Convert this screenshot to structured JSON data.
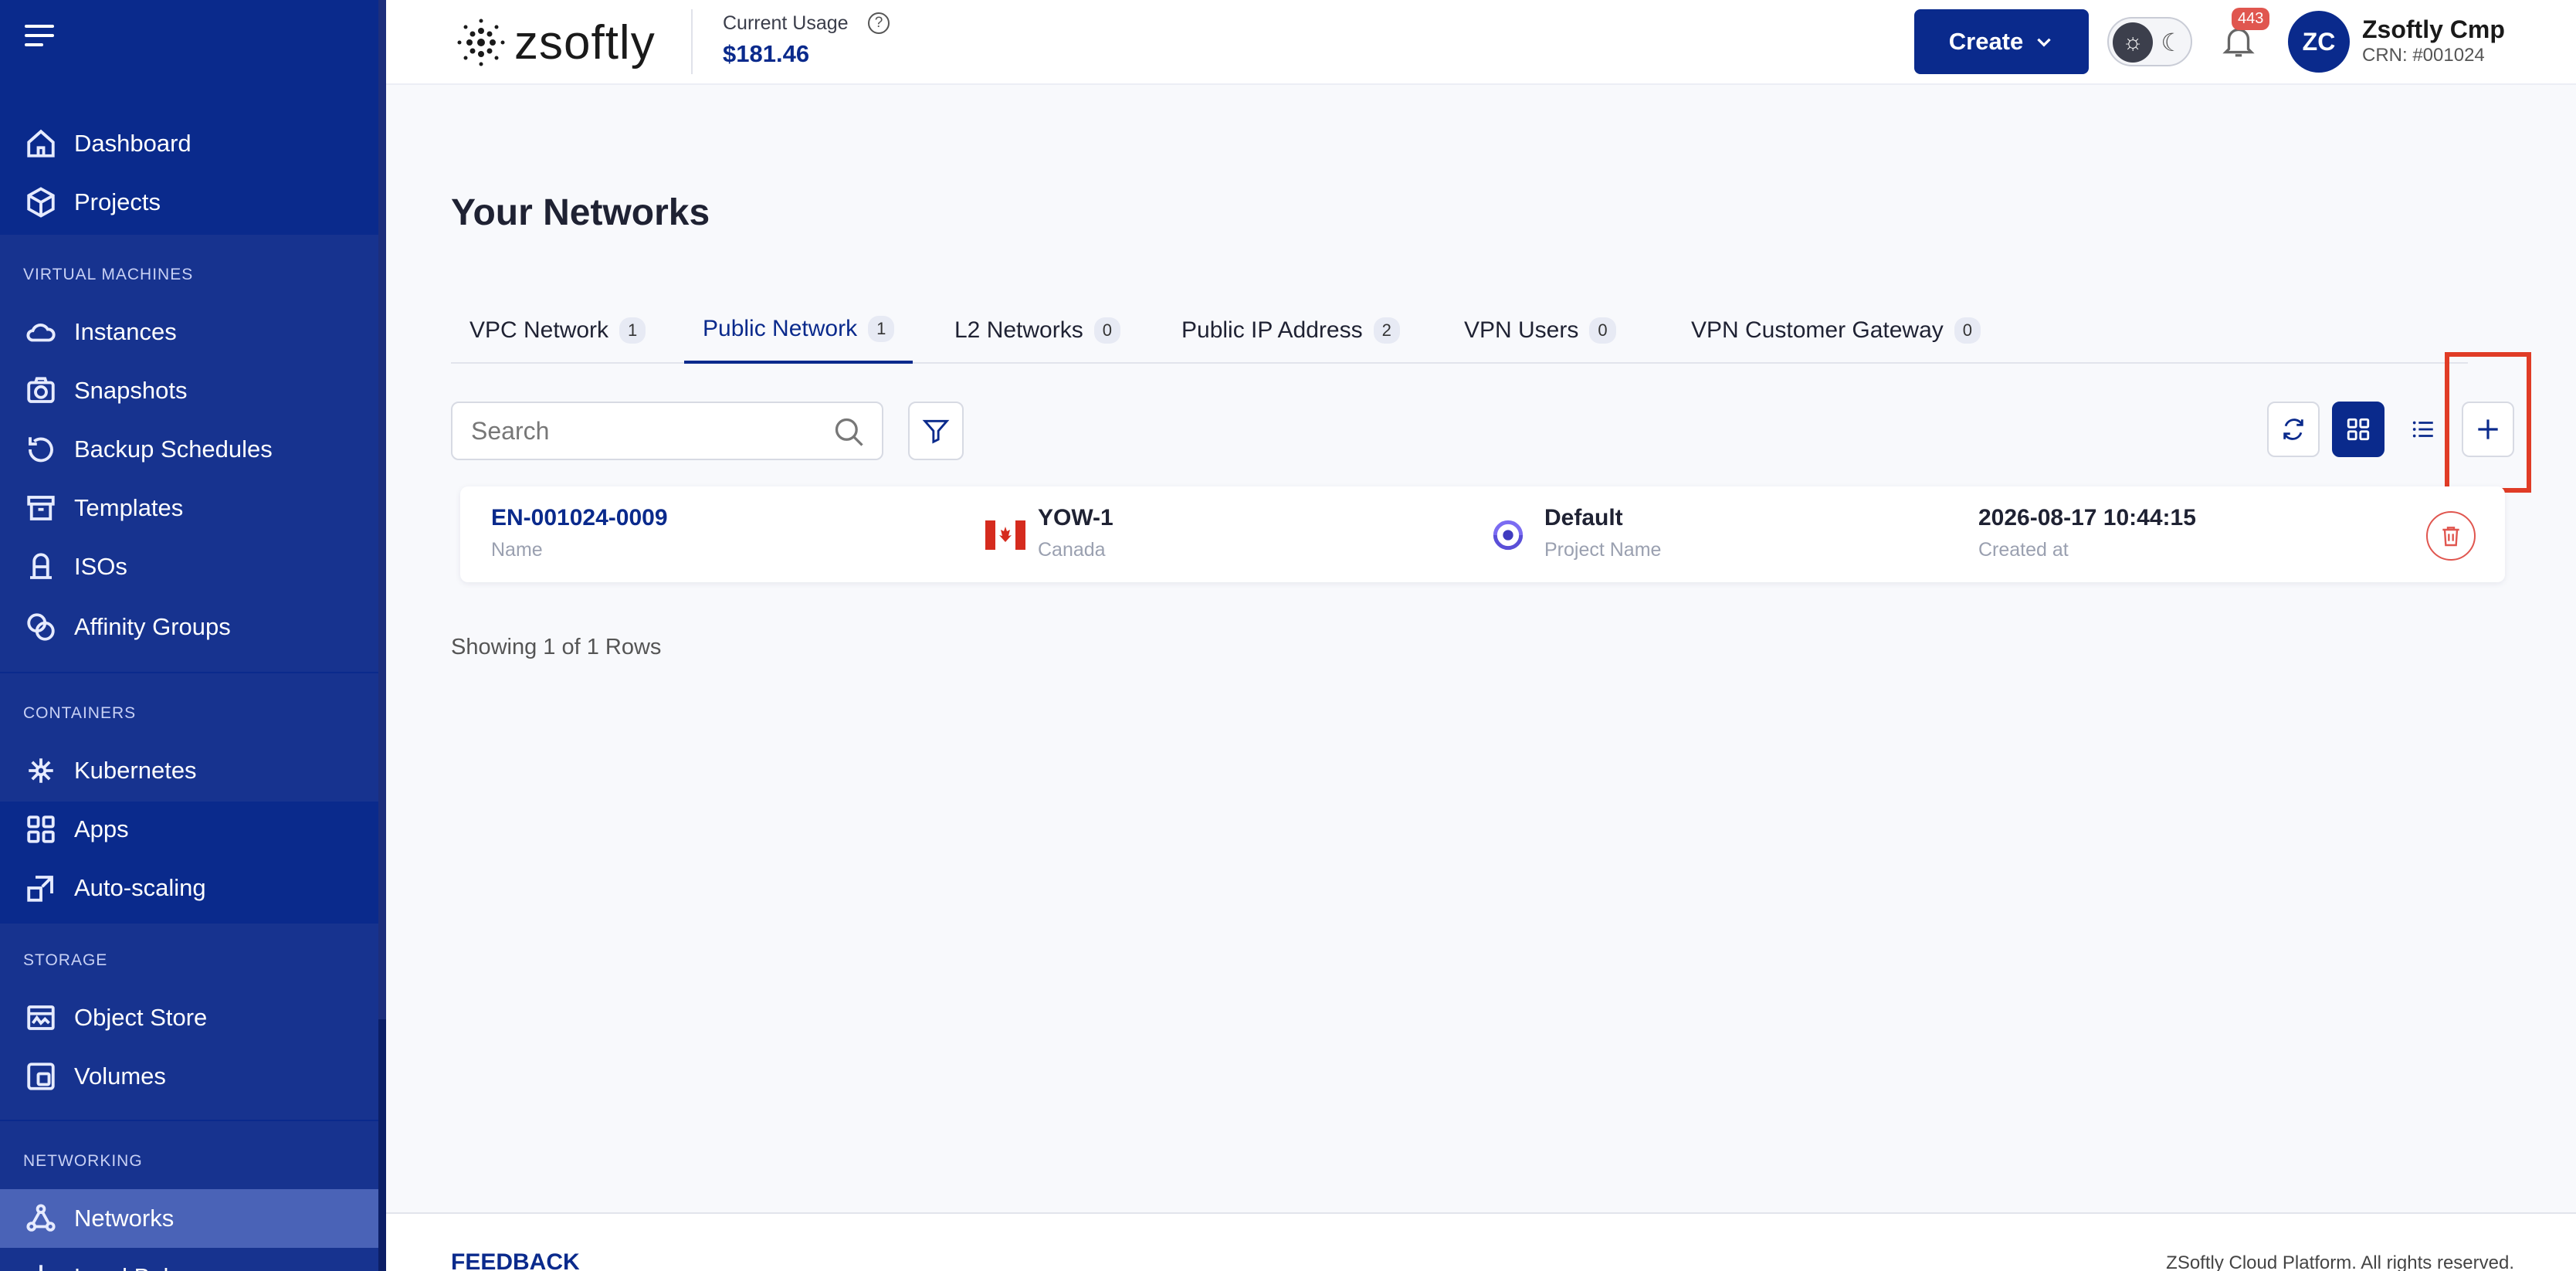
{
  "sidebar": {
    "items": [
      {
        "label": "Dashboard",
        "icon": "home-icon"
      },
      {
        "label": "Projects",
        "icon": "box-icon"
      },
      {
        "label": "Instances",
        "icon": "cloud-icon"
      },
      {
        "label": "Snapshots",
        "icon": "camera-icon"
      },
      {
        "label": "Backup Schedules",
        "icon": "history-icon"
      },
      {
        "label": "Templates",
        "icon": "archive-icon"
      },
      {
        "label": "ISOs",
        "icon": "iso-icon"
      },
      {
        "label": "Affinity Groups",
        "icon": "affinity-icon"
      },
      {
        "label": "Kubernetes",
        "icon": "kubernetes-icon"
      },
      {
        "label": "Apps",
        "icon": "apps-icon"
      },
      {
        "label": "Auto-scaling",
        "icon": "autoscale-icon"
      },
      {
        "label": "Object Store",
        "icon": "object-store-icon"
      },
      {
        "label": "Volumes",
        "icon": "volumes-icon"
      },
      {
        "label": "Networks",
        "icon": "network-icon"
      },
      {
        "label": "Load Bal",
        "icon": "load-balancer-icon"
      }
    ],
    "sections": {
      "virtual_machines": "VIRTUAL MACHINES",
      "containers": "CONTAINERS",
      "storage": "STORAGE",
      "networking": "NETWORKING"
    }
  },
  "header": {
    "logo": "zsoftly",
    "usage_label": "Current Usage",
    "usage_value": "$181.46",
    "create_label": "Create",
    "notification_count": "443",
    "avatar_initials": "ZC",
    "user_name": "Zsoftly Cmp",
    "user_crn": "CRN: #001024"
  },
  "main": {
    "title": "Your Networks",
    "tabs": [
      {
        "label": "VPC Network",
        "count": "1"
      },
      {
        "label": "Public Network",
        "count": "1"
      },
      {
        "label": "L2 Networks",
        "count": "0"
      },
      {
        "label": "Public IP Address",
        "count": "2"
      },
      {
        "label": "VPN Users",
        "count": "0"
      },
      {
        "label": "VPN Customer Gateway",
        "count": "0"
      }
    ],
    "search_placeholder": "Search",
    "rows": [
      {
        "name": "EN-001024-0009",
        "name_label": "Name",
        "zone": "YOW-1",
        "zone_label": "Canada",
        "project": "Default",
        "project_label": "Project Name",
        "created": "2026-08-17 10:44:15",
        "created_label": "Created at"
      }
    ],
    "rows_count": "Showing 1 of 1 Rows"
  },
  "footer": {
    "feedback": "FEEDBACK",
    "copyright": "ZSoftly Cloud Platform. All rights reserved."
  },
  "colors": {
    "primary": "#0a2a8c",
    "sidebar_active": "#4a63b7",
    "danger": "#e0564f",
    "highlight": "#e03c26"
  }
}
